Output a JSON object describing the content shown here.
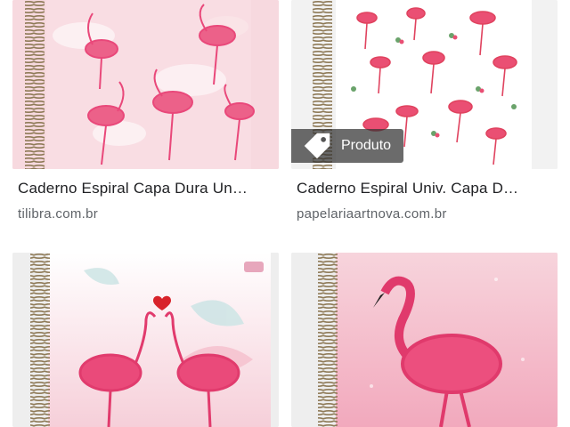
{
  "results": [
    {
      "title": "Caderno Espiral Capa Dura Un…",
      "source": "tilibra.com.br"
    },
    {
      "title": "Caderno Espiral Univ. Capa D…",
      "source": "papelariaartnova.com.br",
      "badge": "Produto"
    },
    {
      "title": "",
      "source": ""
    },
    {
      "title": "",
      "source": ""
    }
  ],
  "icons": {
    "badge": "price-tag-icon"
  },
  "colors": {
    "flamingo": "#e9487a",
    "flamingo_light": "#f48fb1",
    "spiral": "#b9a27a"
  }
}
